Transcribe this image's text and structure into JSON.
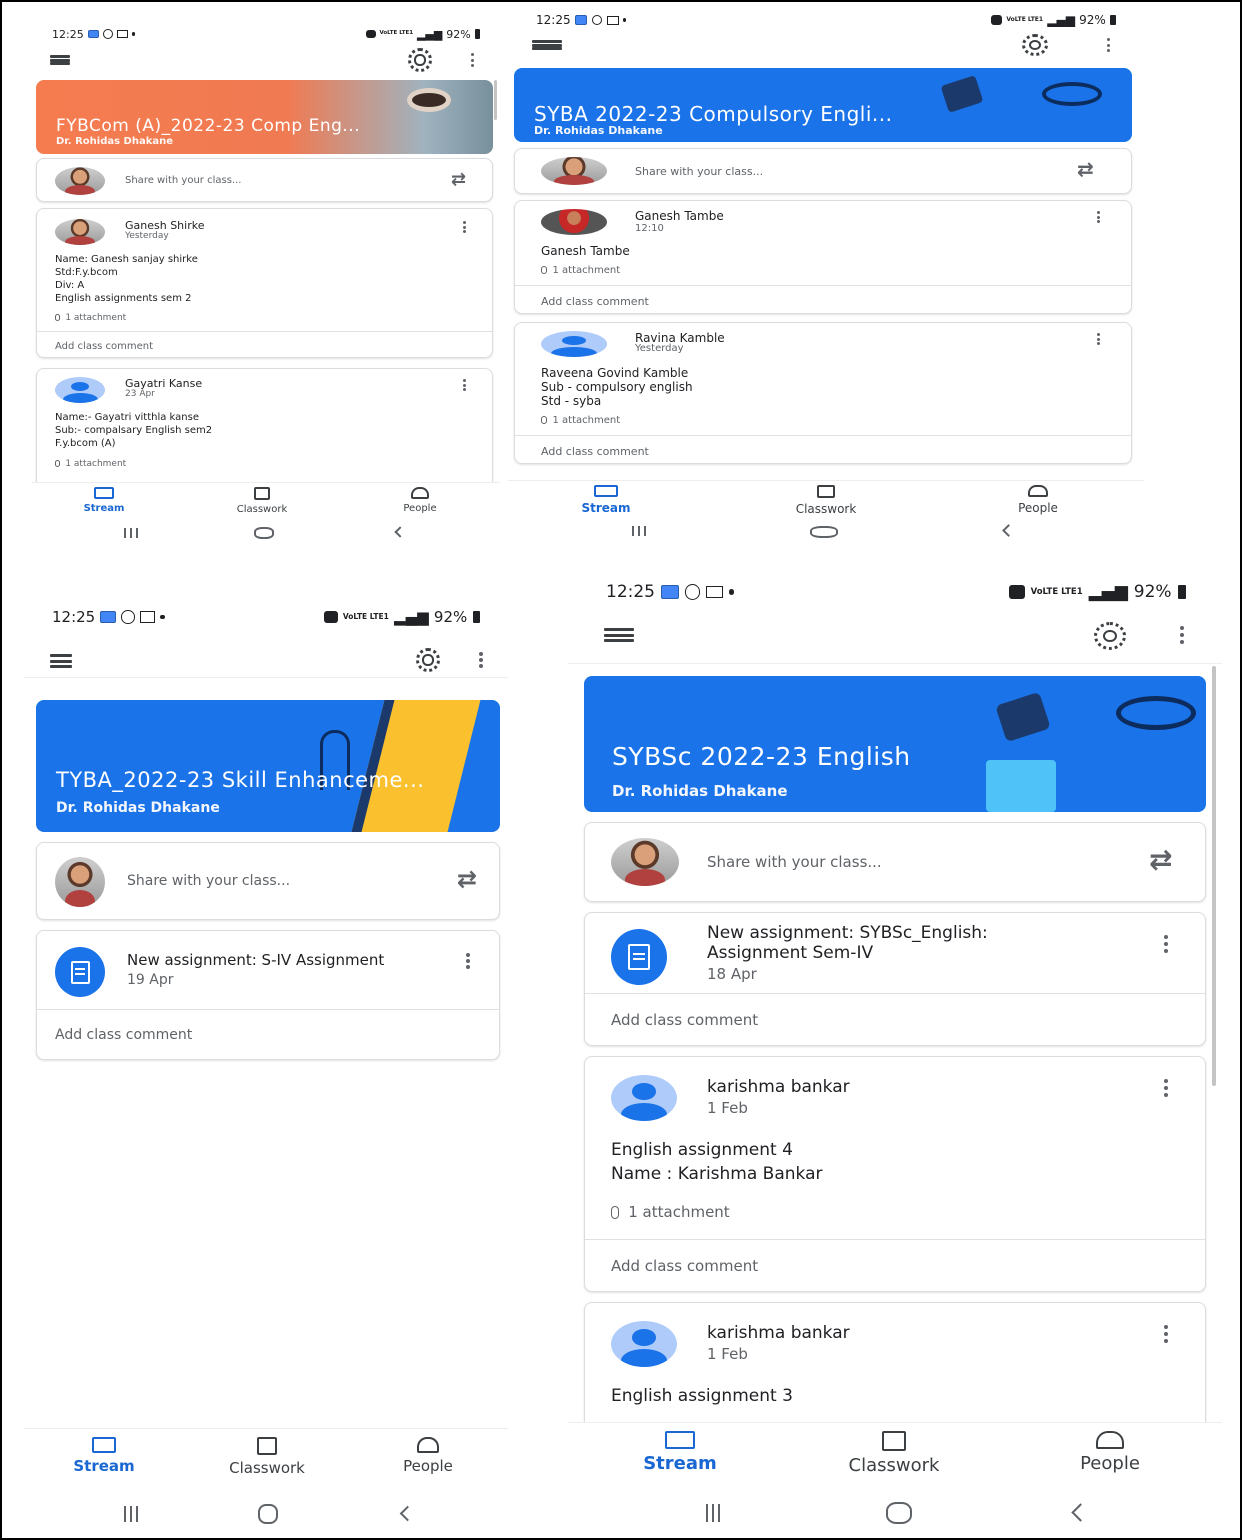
{
  "status": {
    "time": "12:25",
    "lte": "VoLTE LTE1",
    "battery": "92%"
  },
  "nav": {
    "stream": "Stream",
    "classwork": "Classwork",
    "people": "People"
  },
  "share_placeholder": "Share with your class...",
  "add_comment": "Add class comment",
  "colors": {
    "orange_banner": "#f57c4f",
    "blue_banner": "#1a73e8",
    "accent": "#1967d2"
  },
  "phones": {
    "p1": {
      "banner": {
        "title": "FYBCom (A)_2022-23 Comp Eng...",
        "teacher": "Dr. Rohidas Dhakane"
      },
      "posts": [
        {
          "author": "Ganesh Shirke",
          "time": "Yesterday",
          "lines": [
            "Name: Ganesh sanjay shirke",
            "Std:F.y.bcom",
            "Div: A",
            "English assignments  sem 2"
          ],
          "attachment": "1 attachment"
        },
        {
          "author": "Gayatri Kanse",
          "time": "23 Apr",
          "lines": [
            "Name:- Gayatri vitthla kanse",
            "Sub:- compalsary English sem2",
            "F.y.bcom (A)"
          ],
          "attachment": "1 attachment"
        }
      ]
    },
    "p2": {
      "banner": {
        "title": "SYBA 2022-23 Compulsory Engli...",
        "teacher": "Dr. Rohidas Dhakane"
      },
      "posts": [
        {
          "author": "Ganesh Tambe",
          "time": "12:10",
          "lines": [
            "Ganesh Tambe"
          ],
          "attachment": "1 attachment"
        },
        {
          "author": "Ravina Kamble",
          "time": "Yesterday",
          "lines": [
            "Raveena Govind Kamble",
            "Sub - compulsory english",
            "Std - syba"
          ],
          "attachment": "1 attachment"
        }
      ]
    },
    "p3": {
      "banner": {
        "title": "TYBA_2022-23 Skill Enhanceme...",
        "teacher": "Dr. Rohidas Dhakane"
      },
      "assignment": {
        "title": "New assignment: S-IV Assignment",
        "date": "19 Apr"
      }
    },
    "p4": {
      "banner": {
        "title": "SYBSc 2022-23 English",
        "teacher": "Dr. Rohidas Dhakane"
      },
      "assignment": {
        "title_line1": "New assignment: SYBSc_English:",
        "title_line2": "Assignment Sem-IV",
        "date": "18 Apr"
      },
      "posts": [
        {
          "author": "karishma bankar",
          "time": "1 Feb",
          "lines": [
            "English assignment 4",
            "Name : Karishma Bankar"
          ],
          "attachment": "1 attachment"
        },
        {
          "author": "karishma bankar",
          "time": "1 Feb",
          "lines": [
            "English assignment 3"
          ]
        }
      ]
    }
  }
}
